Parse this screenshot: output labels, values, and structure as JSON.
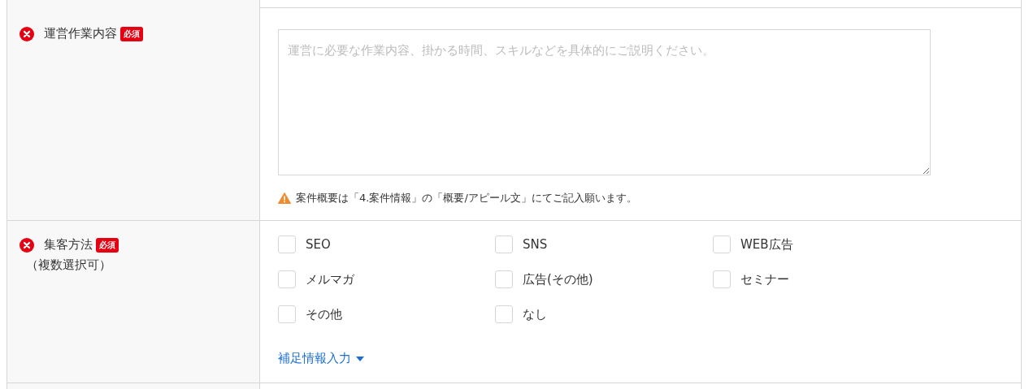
{
  "rows": [
    {
      "kind": "textarea",
      "label": "運営作業内容",
      "required_badge": "必須",
      "error": true,
      "placeholder": "運営に必要な作業内容、掛かる時間、スキルなどを具体的にご説明ください。",
      "note": "案件概要は「4.案件情報」の「概要/アピール文」にてご記入願います。"
    },
    {
      "kind": "checkboxes",
      "label": "集客方法",
      "required_badge": "必須",
      "error": true,
      "sublabel": "（複数選択可）",
      "options": [
        {
          "label": "SEO",
          "checked": false
        },
        {
          "label": "SNS",
          "checked": false
        },
        {
          "label": "WEB広告",
          "checked": false
        },
        {
          "label": "メルマガ",
          "checked": false
        },
        {
          "label": "広告(その他)",
          "checked": false
        },
        {
          "label": "セミナー",
          "checked": false
        },
        {
          "label": "その他",
          "checked": false
        },
        {
          "label": "なし",
          "checked": false
        }
      ],
      "toggle_link": "補足情報入力"
    }
  ]
}
